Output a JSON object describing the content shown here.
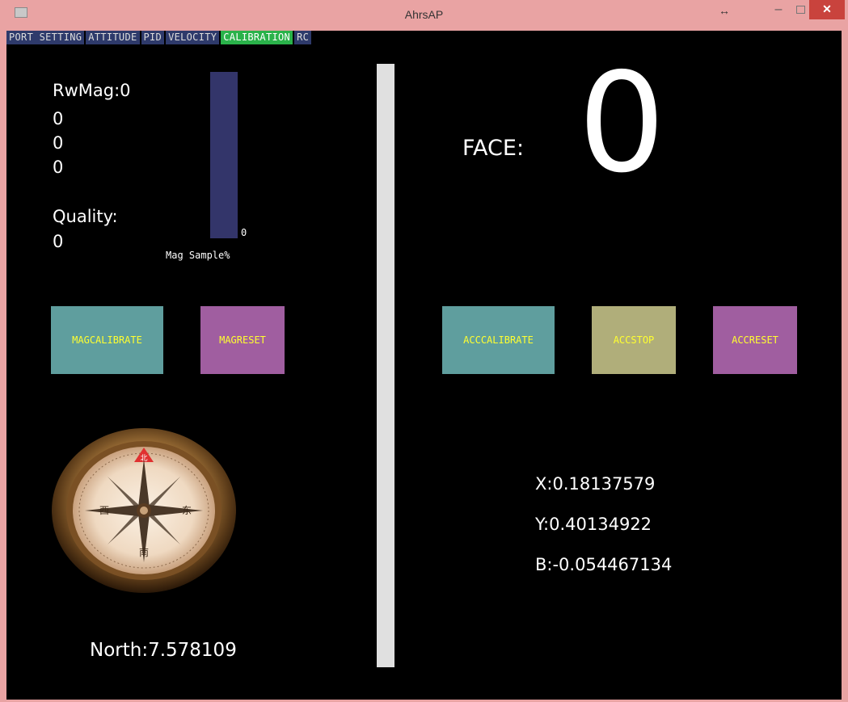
{
  "window": {
    "title": "AhrsAP",
    "controls": {
      "resize": "↔",
      "minimize": "–",
      "close": "✕"
    }
  },
  "tabs": [
    {
      "label": "PORT SETTING",
      "active": false
    },
    {
      "label": "ATTITUDE",
      "active": false
    },
    {
      "label": "PID",
      "active": false
    },
    {
      "label": "VELOCITY",
      "active": false
    },
    {
      "label": "CALIBRATION",
      "active": true
    },
    {
      "label": "RC",
      "active": false
    }
  ],
  "mag": {
    "rw_mag": "RwMag:0",
    "values": [
      "0",
      "0",
      "0"
    ],
    "quality_label": "Quality:",
    "quality_value": "0",
    "sample_percent": "0",
    "sample_label": "Mag Sample%",
    "calibrate_label": "MAGCALIBRATE",
    "reset_label": "MAGRESET",
    "north": "North:7.578109"
  },
  "acc": {
    "face_label": "FACE:",
    "face_value": "0",
    "calibrate_label": "ACCCALIBRATE",
    "stop_label": "ACCSTOP",
    "reset_label": "ACCRESET",
    "x": "X:0.18137579",
    "y": "Y:0.40134922",
    "b": "B:-0.054467134"
  },
  "compass_labels": {
    "north": "北",
    "south": "南",
    "east": "东",
    "west": "西"
  },
  "colors": {
    "tab_bg": "#2e3a6b",
    "tab_active": "#2ab24a",
    "teal_button": "#5f9e9e",
    "purple_button": "#a05ea0",
    "olive_button": "#b0ae7a",
    "button_text": "#ffff30",
    "mag_bar": "#33356a"
  },
  "icons": [
    "app-icon",
    "resize-icon",
    "minimize-icon",
    "maximize-icon",
    "close-icon",
    "compass-icon"
  ]
}
